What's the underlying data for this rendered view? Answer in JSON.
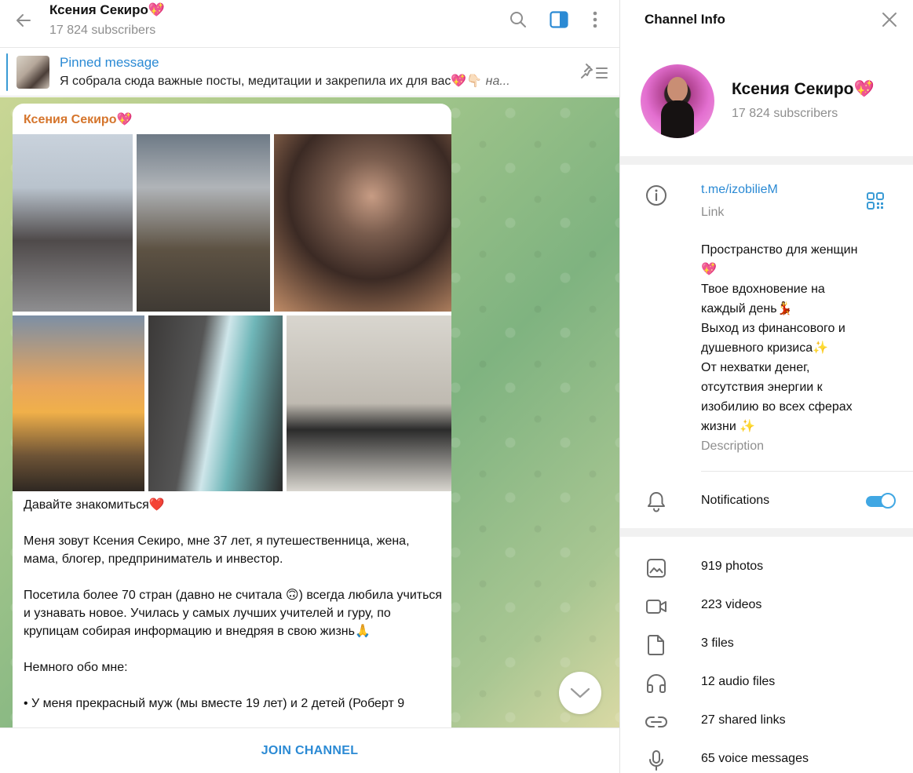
{
  "header": {
    "title": "Ксения Секиро💖",
    "subscribers": "17 824 subscribers"
  },
  "pinned": {
    "title": "Pinned message",
    "text": "Я собрала сюда важные посты, медитации и закрепила их для вас💖👇🏻 ",
    "more": "на..."
  },
  "message": {
    "author": "Ксения Секиро💖",
    "text": "Давайте знакомиться❤️\n\nМеня зовут Ксения Секиро, мне 37 лет, я путешественница, жена, мама, блогер, предприниматель и инвестор.\n\nПосетила более 70 стран (давно не считала 🙃) всегда любила учиться и узнавать новое. Училась  у самых лучших учителей и гуру, по крупицам собирая информацию и внедряя в свою жизнь🙏\n\nНемного обо мне:\n\n• У меня прекрасный муж (мы вместе 19 лет) и 2 детей (Роберт 9"
  },
  "join_label": "JOIN CHANNEL",
  "info": {
    "title": "Channel Info",
    "name": "Ксения Секиро💖",
    "subscribers": "17 824 subscribers",
    "link": "t.me/izobilieM",
    "link_label": "Link",
    "description": "Пространство для женщин\n💖\nТвое вдохновение на\nкаждый день💃\nВыход из финансового и\nдушевного кризиса✨\nОт нехватки денег,\nотсутствия энергии к\nизобилию во всех сферах\nжизни ✨",
    "description_label": "Description",
    "notifications": "Notifications",
    "notifications_on": true,
    "media": [
      {
        "label": "919 photos",
        "icon": "photo-icon"
      },
      {
        "label": "223 videos",
        "icon": "video-icon"
      },
      {
        "label": "3 files",
        "icon": "file-icon"
      },
      {
        "label": "12 audio files",
        "icon": "headphones-icon"
      },
      {
        "label": "27 shared links",
        "icon": "link-icon"
      },
      {
        "label": "65 voice messages",
        "icon": "microphone-icon"
      }
    ]
  },
  "colors": {
    "accent": "#2b8ad4",
    "author": "#d5752c",
    "toggle": "#40a7e3"
  }
}
